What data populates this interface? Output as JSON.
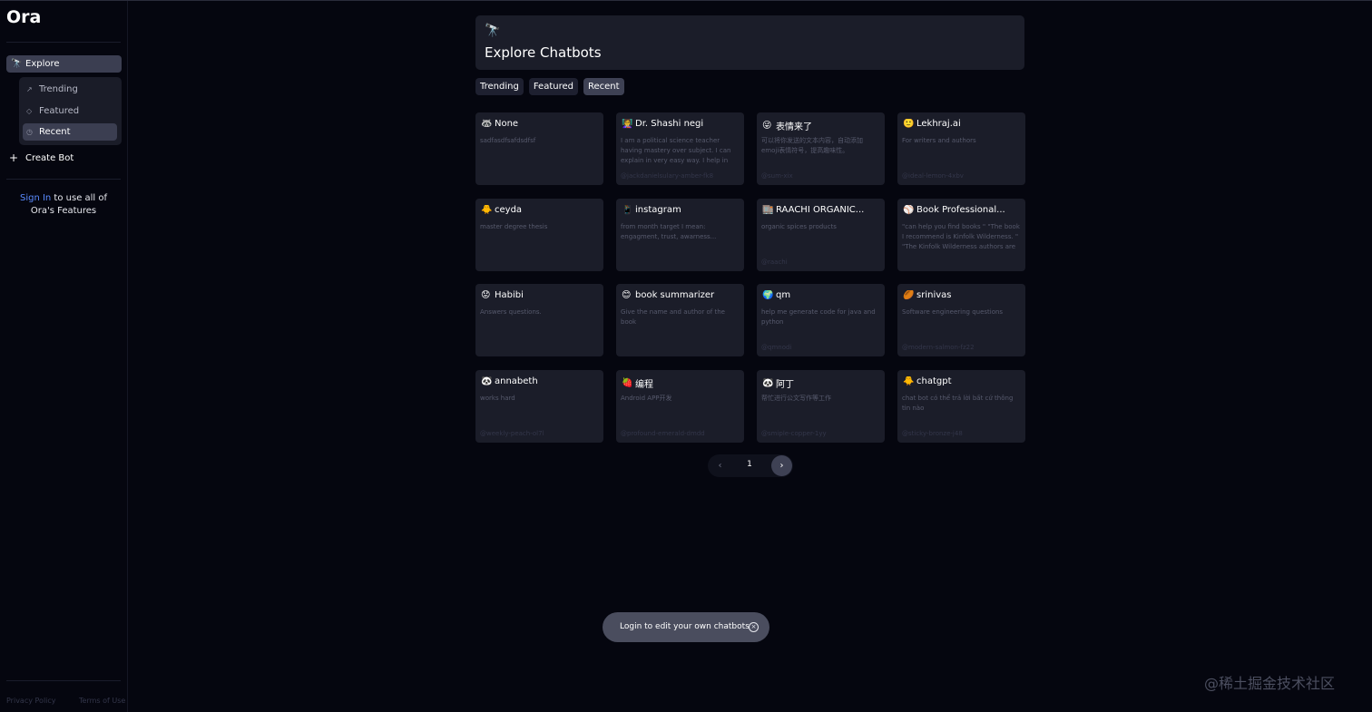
{
  "app": {
    "title": "Ora"
  },
  "sidebar": {
    "explore": {
      "label": "Explore",
      "icon": "telescope-icon"
    },
    "subitems": [
      {
        "label": "Trending",
        "icon": "trending-icon"
      },
      {
        "label": "Featured",
        "icon": "gem-icon"
      },
      {
        "label": "Recent",
        "icon": "clock-icon",
        "active": true
      }
    ],
    "create_bot": "Create Bot",
    "signin_link": "Sign In",
    "signin_line1": " to use all of",
    "signin_line2": "Ora's Features",
    "privacy": "Privacy Policy",
    "terms": "Terms of Use"
  },
  "header": {
    "title": "Explore Chatbots",
    "icon": "telescope-icon"
  },
  "tabs": [
    {
      "label": "Trending"
    },
    {
      "label": "Featured"
    },
    {
      "label": "Recent",
      "active": true
    }
  ],
  "bots": [
    {
      "emoji": "🦝",
      "name": "None",
      "desc": "sadfasdfsafdsdfsf",
      "handle": ""
    },
    {
      "emoji": "👩‍🏫",
      "name": "Dr. Shashi negi",
      "desc": "I am a political science teacher having mastery over subject. I can explain in very easy way. I help in generating...",
      "handle": "@jackdanielsulary-amber-fk8"
    },
    {
      "emoji": "😜",
      "name": "表情来了",
      "desc": "可以将你发送的文本内容，自动添加emoji表情符号，提高趣味性。",
      "handle": "@sum-xix"
    },
    {
      "emoji": "🙂",
      "name": "Lekhraj.ai",
      "desc": "For writers and authors",
      "handle": "@ideal-lemon-4xbv"
    },
    {
      "emoji": "🐥",
      "name": "ceyda",
      "desc": "master degree thesis",
      "handle": ""
    },
    {
      "emoji": "📱",
      "name": "instagram",
      "desc": "from month target I mean: engagment, trust, awarness...",
      "handle": ""
    },
    {
      "emoji": "🏬",
      "name": "RAACHI ORGANIC...",
      "desc": "organic spices products",
      "handle": "@raachi"
    },
    {
      "emoji": "⚾",
      "name": "Book Professional...",
      "desc": "\"can help you find books \" \"The book I recommend is Kinfolk Wilderness. \" \"The Kinfolk Wilderness authors are Burns an...",
      "handle": ""
    },
    {
      "emoji": "😟",
      "name": "Habibi",
      "desc": "Answers questions.",
      "handle": ""
    },
    {
      "emoji": "😊",
      "name": "book summarizer",
      "desc": "Give the name and author of the book",
      "handle": ""
    },
    {
      "emoji": "🌍",
      "name": "qm",
      "desc": "help me generate code for java and python",
      "handle": "@qmnodi"
    },
    {
      "emoji": "🏉",
      "name": "srinivas",
      "desc": "Software engineering questions",
      "handle": "@modern-salmon-fz22"
    },
    {
      "emoji": "🐼",
      "name": "annabeth",
      "desc": "works hard",
      "handle": "@weekly-peach-ol7l"
    },
    {
      "emoji": "🍓",
      "name": "编程",
      "desc": "Android APP开发",
      "handle": "@profound-emerald-dmdd"
    },
    {
      "emoji": "🐼",
      "name": "阿丁",
      "desc": "帮忙进行公文写作等工作",
      "handle": "@smiple-copper-1yy"
    },
    {
      "emoji": "🐥",
      "name": "chatgpt",
      "desc": "chat bot có thể trả lời bất cứ thông tin nào",
      "handle": "@sticky-bronze-j48"
    }
  ],
  "pagination": {
    "current": "1",
    "prev_icon": "chevron-left-icon",
    "next_icon": "chevron-right-icon"
  },
  "toast": {
    "text": "Login to edit your own chatbots",
    "close_icon": "close-circle-icon"
  },
  "watermark": "@稀土掘金技术社区"
}
